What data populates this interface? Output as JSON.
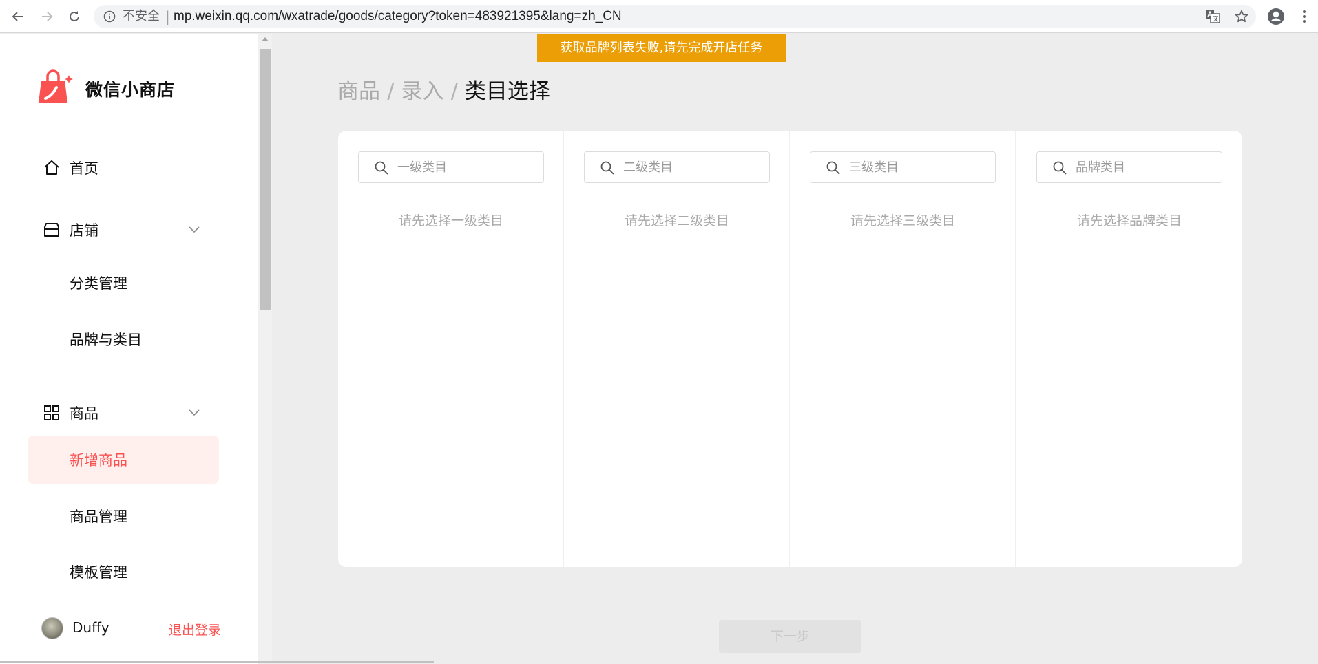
{
  "browser": {
    "insecure_label": "不安全",
    "separator": "|",
    "url": "mp.weixin.qq.com/wxatrade/goods/category?token=483921395&lang=zh_CN"
  },
  "sidebar": {
    "brand_name": "微信小商店",
    "nav": {
      "home": "首页",
      "store": "店铺",
      "store_sub": [
        "分类管理",
        "品牌与类目"
      ],
      "goods": "商品",
      "goods_sub": [
        "新增商品",
        "商品管理",
        "模板管理"
      ]
    },
    "active_item": "新增商品",
    "user_name": "Duffy",
    "logout_label": "退出登录"
  },
  "toast": "获取品牌列表失败,请先完成开店任务",
  "breadcrumb": {
    "items": [
      "商品",
      "录入"
    ],
    "separator": "/",
    "current": "类目选择"
  },
  "columns": [
    {
      "placeholder": "一级类目",
      "empty_text": "请先选择一级类目"
    },
    {
      "placeholder": "二级类目",
      "empty_text": "请先选择二级类目"
    },
    {
      "placeholder": "三级类目",
      "empty_text": "请先选择三级类目"
    },
    {
      "placeholder": "品牌类目",
      "empty_text": "请先选择品牌类目"
    }
  ],
  "next_button": "下一步",
  "colors": {
    "accent": "#fa5151",
    "toast_bg": "#eb9e05",
    "active_bg": "#fff0ee"
  }
}
